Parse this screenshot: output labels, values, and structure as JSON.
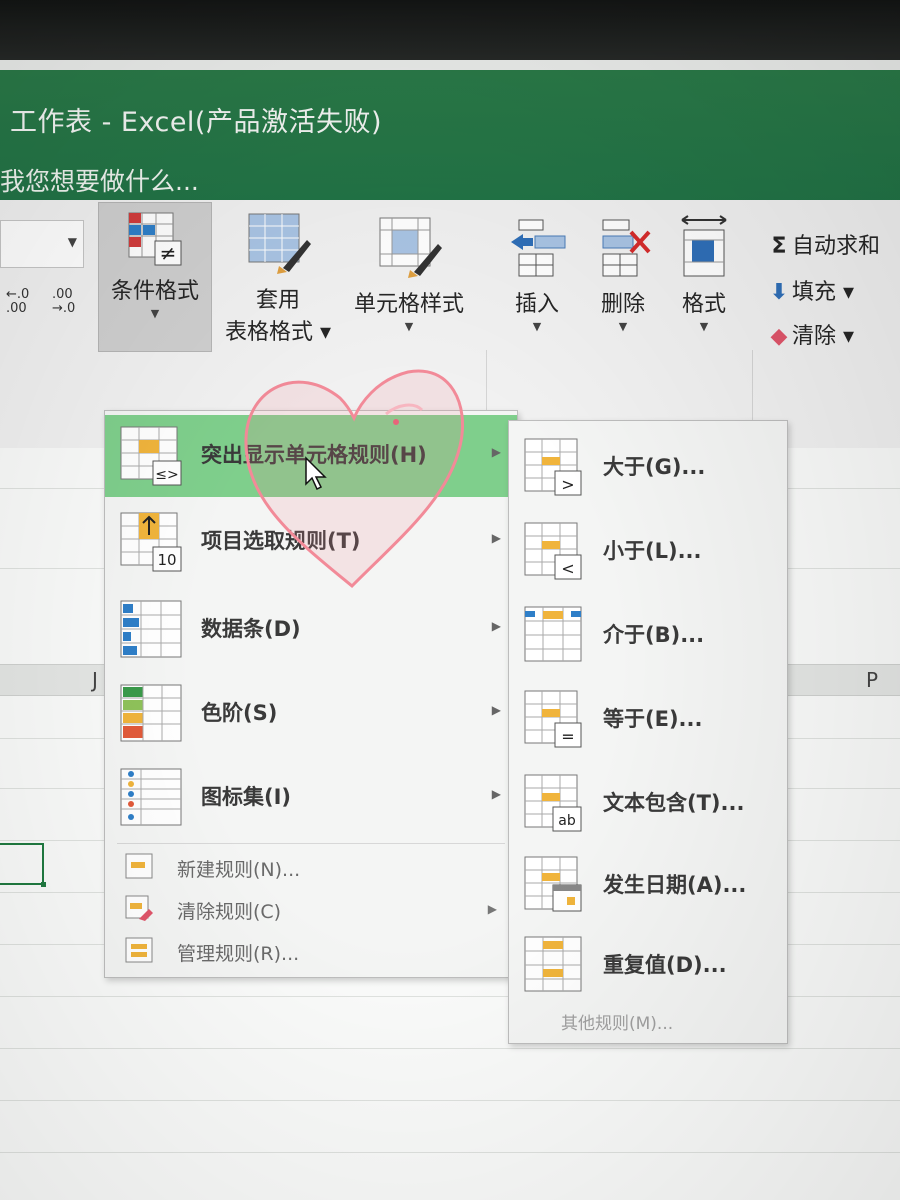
{
  "window": {
    "title": "工作表 - Excel(产品激活失败)",
    "tell_me": "我您想要做什么..."
  },
  "ribbon": {
    "decimal_increase": "←.0\n.00",
    "decimal_decrease": ".00\n→.0",
    "conditional_formatting": "条件格式",
    "format_as_table_1": "套用",
    "format_as_table_2": "表格格式 ▾",
    "cell_styles": "单元格样式",
    "insert": "插入",
    "delete": "删除",
    "format": "格式",
    "autosum_icon_text": "Σ",
    "autosum": "自动求和",
    "fill": "填充 ▾",
    "clear": "清除 ▾"
  },
  "sheet": {
    "column_j": "J",
    "column_p": "P"
  },
  "cf_menu": {
    "items": [
      {
        "label": "突出显示单元格规则(H)",
        "icon": "highlight-rules-icon",
        "icon_text": "≤>"
      },
      {
        "label": "项目选取规则(T)",
        "icon": "top-bottom-rules-icon",
        "icon_text": "10"
      },
      {
        "label": "数据条(D)",
        "icon": "data-bars-icon"
      },
      {
        "label": "色阶(S)",
        "icon": "color-scales-icon"
      },
      {
        "label": "图标集(I)",
        "icon": "icon-sets-icon"
      }
    ],
    "secondary": [
      {
        "label": "新建规则(N)..."
      },
      {
        "label": "清除规则(C)"
      },
      {
        "label": "管理规则(R)..."
      }
    ]
  },
  "submenu": {
    "items": [
      {
        "label": "大于(G)...",
        "icon": "greater-than-icon",
        "icon_text": ">"
      },
      {
        "label": "小于(L)...",
        "icon": "less-than-icon",
        "icon_text": "<"
      },
      {
        "label": "介于(B)...",
        "icon": "between-icon"
      },
      {
        "label": "等于(E)...",
        "icon": "equal-to-icon",
        "icon_text": "="
      },
      {
        "label": "文本包含(T)...",
        "icon": "text-contains-icon",
        "icon_text": "ab"
      },
      {
        "label": "发生日期(A)...",
        "icon": "date-occurring-icon"
      },
      {
        "label": "重复值(D)...",
        "icon": "duplicate-values-icon"
      }
    ],
    "more_rules": "其他规则(M)..."
  },
  "colors": {
    "excel_green": "#217346",
    "active_item": "#7fcf8c",
    "cell_yellow": "#f0b43c",
    "bar_blue": "#2f7fc8",
    "heart_pink": "#f28a98"
  }
}
